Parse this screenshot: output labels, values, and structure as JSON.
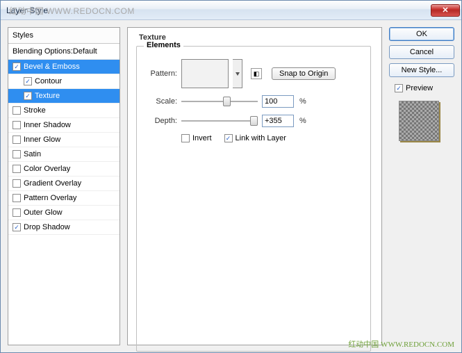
{
  "window": {
    "title": "Layer Style"
  },
  "watermarks": {
    "top": "红动中国 WWW.REDOCN.COM",
    "bottom": "红动中国 WWW.REDOCN.COM"
  },
  "close": "✕",
  "styles": {
    "header": "Styles",
    "blending": "Blending Options:Default",
    "items": [
      {
        "label": "Bevel & Emboss",
        "checked": true,
        "selected": true,
        "child": false
      },
      {
        "label": "Contour",
        "checked": true,
        "selected": false,
        "child": true
      },
      {
        "label": "Texture",
        "checked": true,
        "selected": true,
        "child": true
      },
      {
        "label": "Stroke",
        "checked": false,
        "selected": false,
        "child": false
      },
      {
        "label": "Inner Shadow",
        "checked": false,
        "selected": false,
        "child": false
      },
      {
        "label": "Inner Glow",
        "checked": false,
        "selected": false,
        "child": false
      },
      {
        "label": "Satin",
        "checked": false,
        "selected": false,
        "child": false
      },
      {
        "label": "Color Overlay",
        "checked": false,
        "selected": false,
        "child": false
      },
      {
        "label": "Gradient Overlay",
        "checked": false,
        "selected": false,
        "child": false
      },
      {
        "label": "Pattern Overlay",
        "checked": false,
        "selected": false,
        "child": false
      },
      {
        "label": "Outer Glow",
        "checked": false,
        "selected": false,
        "child": false
      },
      {
        "label": "Drop Shadow",
        "checked": true,
        "selected": false,
        "child": false
      }
    ]
  },
  "texture": {
    "title": "Texture",
    "legend": "Elements",
    "pattern_label": "Pattern:",
    "snap_btn": "Snap to Origin",
    "scale_label": "Scale:",
    "scale_value": "100",
    "depth_label": "Depth:",
    "depth_value": "+355",
    "percent": "%",
    "invert_label": "Invert",
    "invert_checked": false,
    "link_label": "Link with Layer",
    "link_checked": true
  },
  "buttons": {
    "ok": "OK",
    "cancel": "Cancel",
    "new_style": "New Style...",
    "preview": "Preview",
    "preview_checked": true
  }
}
